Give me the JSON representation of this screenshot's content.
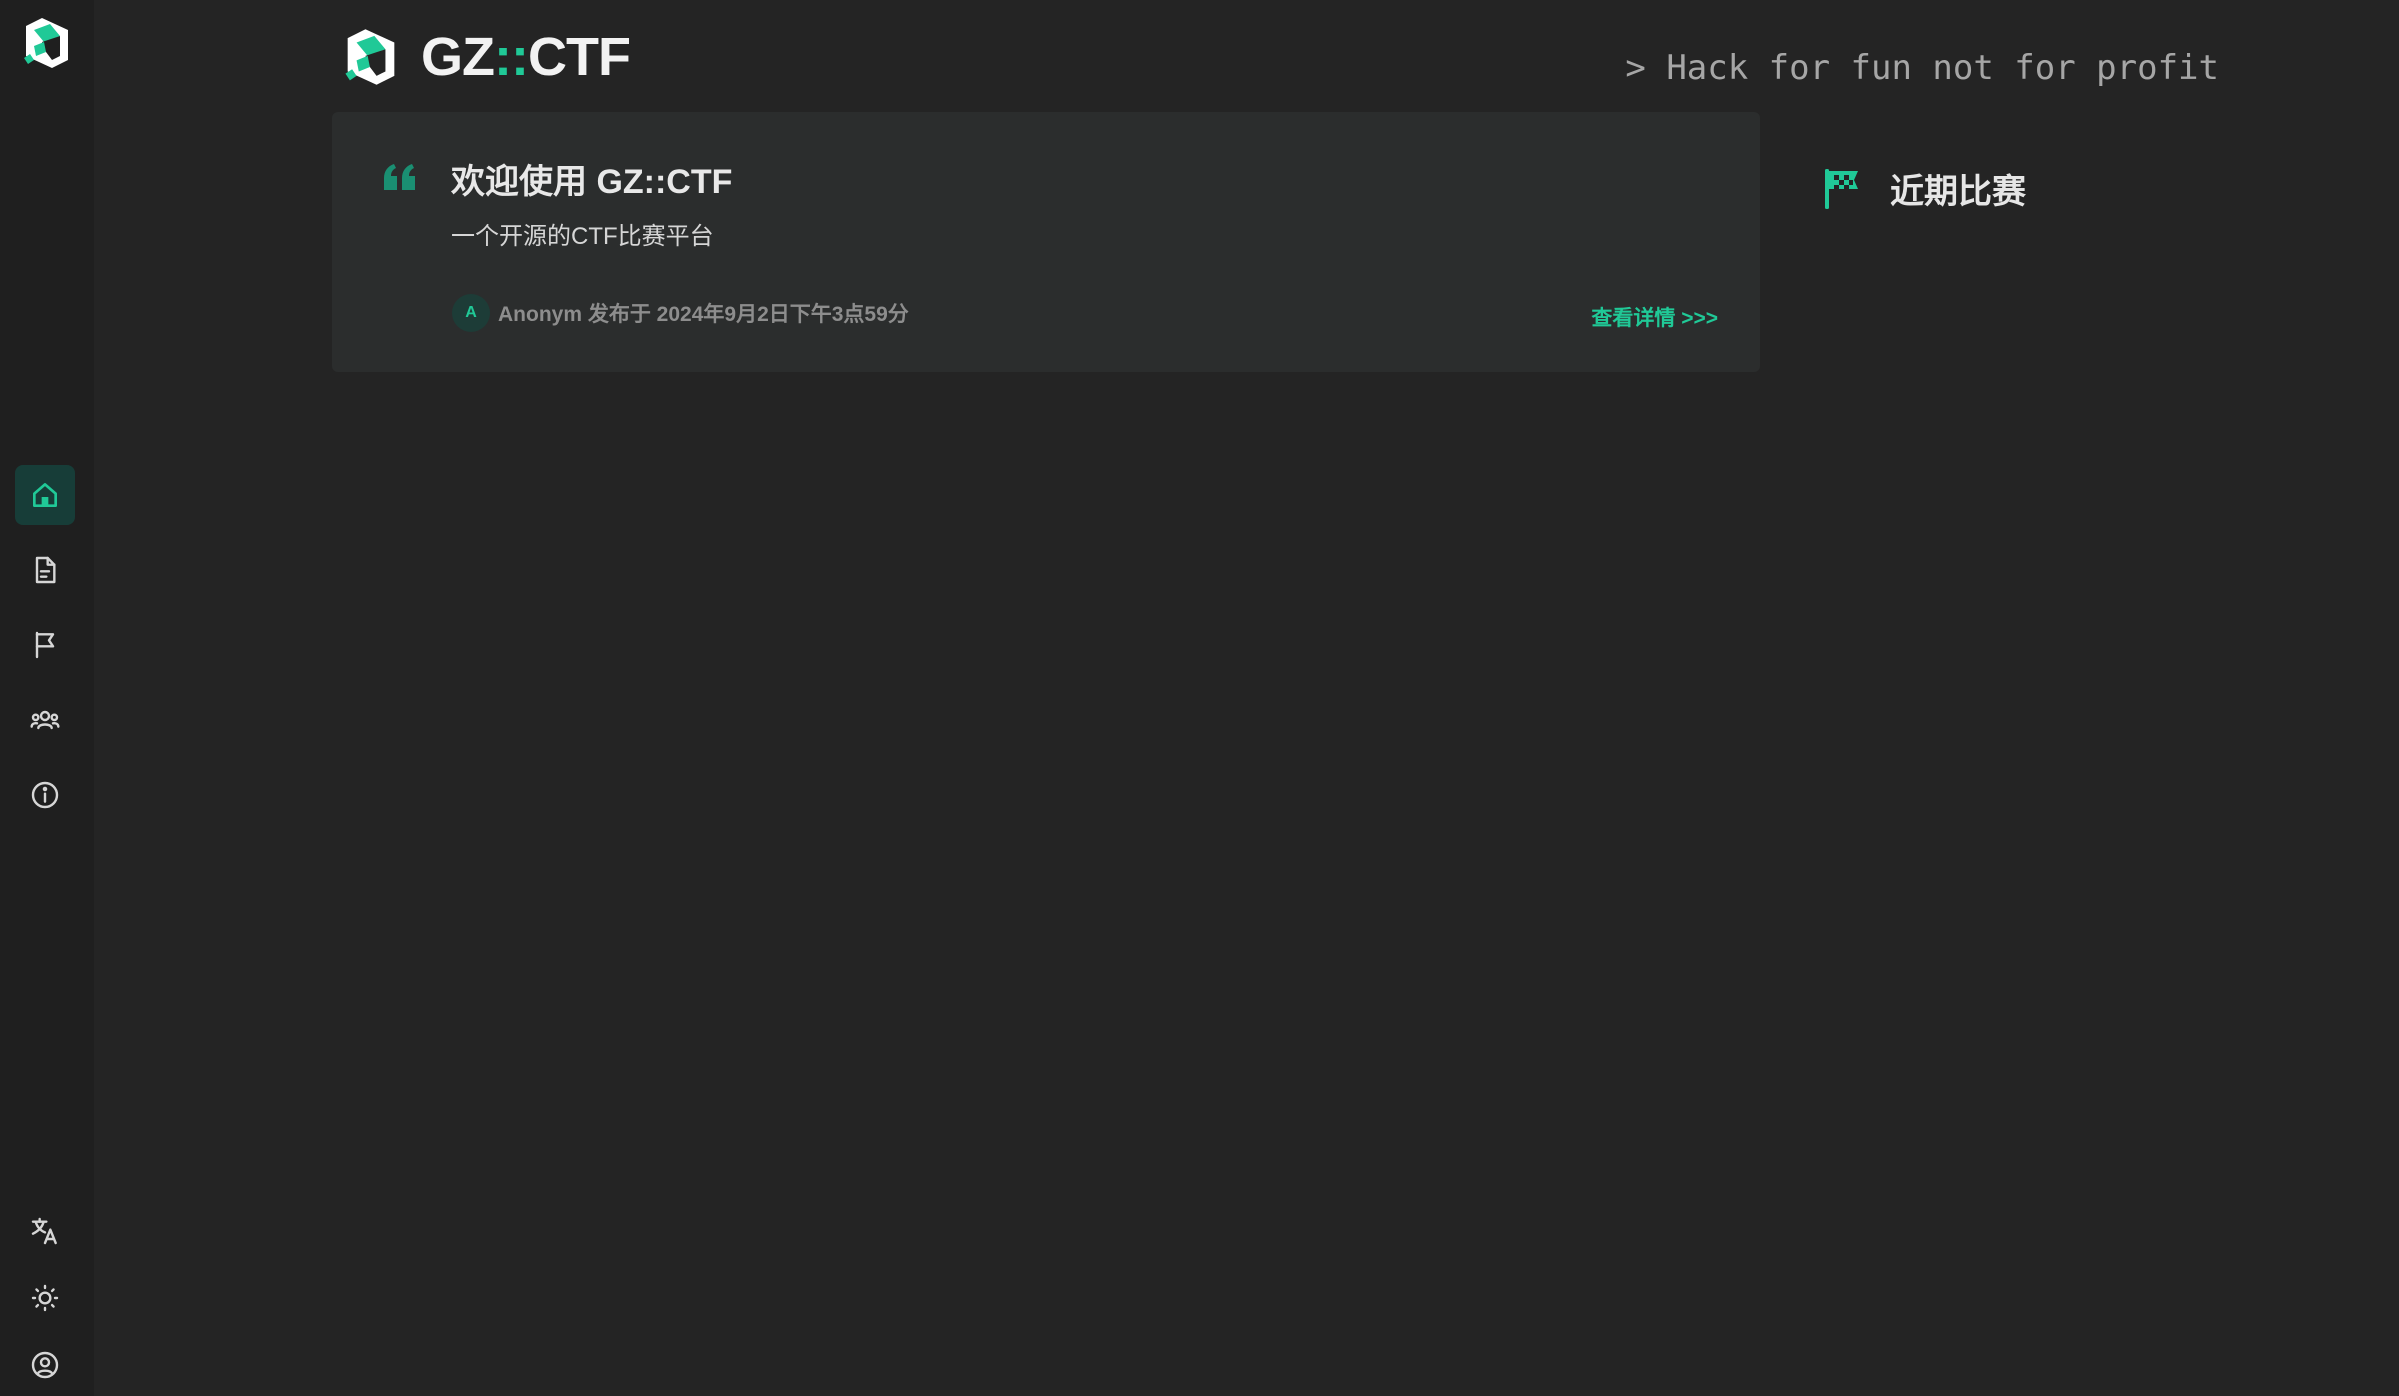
{
  "brand": {
    "prefix": "GZ",
    "separator": "::",
    "suffix": "CTF"
  },
  "slogan": "> Hack for fun not for profit",
  "notice": {
    "title": "欢迎使用 GZ::CTF",
    "body": "一个开源的CTF比赛平台",
    "avatar_letter": "A",
    "meta": "Anonym 发布于 2024年9月2日下午3点59分",
    "detail_link": "查看详情 >>>"
  },
  "recent_games": {
    "title": "近期比赛"
  },
  "nav": {
    "items": [
      {
        "name": "home",
        "icon": "home-icon",
        "active": true
      },
      {
        "name": "posts",
        "icon": "file-text-icon",
        "active": false
      },
      {
        "name": "games",
        "icon": "flag-icon",
        "active": false
      },
      {
        "name": "teams",
        "icon": "users-icon",
        "active": false
      },
      {
        "name": "about",
        "icon": "info-icon",
        "active": false
      }
    ],
    "bottom": [
      {
        "name": "language",
        "icon": "translate-icon"
      },
      {
        "name": "theme",
        "icon": "sun-icon"
      },
      {
        "name": "profile",
        "icon": "user-circle-icon"
      }
    ]
  },
  "colors": {
    "accent": "#20c997",
    "background": "#242424",
    "sidebar": "#1f1f1f",
    "card": "#2b2d2d"
  }
}
